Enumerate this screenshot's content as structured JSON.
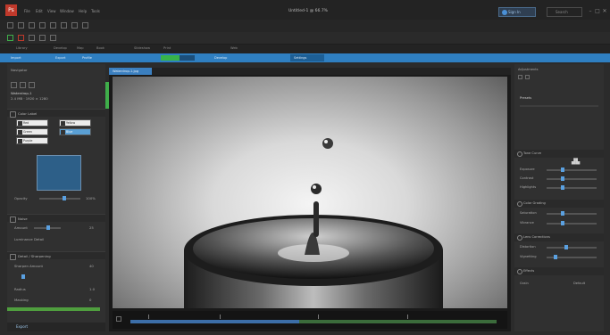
{
  "window": {
    "app_icon": "Ps",
    "title": "Untitled-1 @ 66.7%",
    "menu": [
      "File",
      "Edit",
      "View",
      "Window",
      "Help",
      "Tools"
    ],
    "user_button": "Sign In",
    "search_button": "Search",
    "controls": [
      "–",
      "□",
      "✕"
    ]
  },
  "top_tabs": [
    "Library",
    "Develop",
    "Map",
    "Book",
    "Slideshow",
    "Print",
    "Web"
  ],
  "bluebar": {
    "items": [
      "Import",
      "Export",
      "Profile",
      "Develop"
    ],
    "progress": 0.55,
    "selected": "Settings"
  },
  "left_panel": {
    "header": "Navigator",
    "file_name": "Waterdrop-1",
    "file_info": "2.4 MB · 1920 × 1280",
    "section_color": "Color Label",
    "buttons": [
      "Red",
      "Yellow",
      "Green",
      "Blue",
      "Purple",
      "None"
    ],
    "active_button_index": 3,
    "swatch_color": "#2d5f88",
    "slider_label": "Opacity",
    "slider_value": "100%",
    "section_noise": "Noise",
    "noise_label": "Amount",
    "noise_value": "25",
    "noise_sub": "Luminance Detail",
    "section_sharpen": "Detail / Sharpening",
    "sharpen_label": "Sharpen Amount",
    "sharpen_value": "40",
    "radius_label": "Radius",
    "radius_value": "1.0",
    "masking_label": "Masking",
    "masking_value": "0",
    "bottom": "Export"
  },
  "viewer": {
    "tab": "Waterdrop-1.jpg",
    "timeline_progress": 0.46
  },
  "right_panel": {
    "header": "Adjustments",
    "sub": "Presets",
    "tone_section": "Tone Curve",
    "sliders1": [
      "Exposure",
      "Contrast",
      "Highlights"
    ],
    "section2": "Color Grading",
    "sliders2": [
      "Saturation",
      "Vibrance"
    ],
    "section3": "Lens Corrections",
    "sliders3": [
      "Distortion",
      "Vignetting"
    ],
    "section4": "Effects",
    "effects_label": "Grain",
    "effects_value": "Default"
  }
}
